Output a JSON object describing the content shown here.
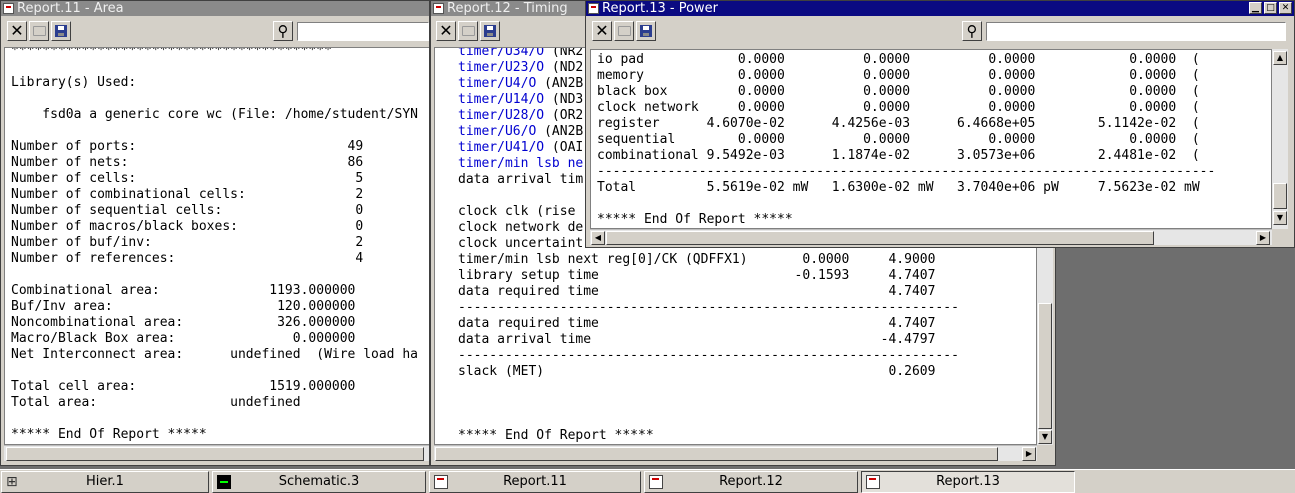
{
  "windows": {
    "area": {
      "title": "Report.11 - Area",
      "lines": [
        "*****************************************",
        "",
        "Library(s) Used:",
        "",
        "    fsd0a a generic core wc (File: /home/student/SYN",
        "",
        "Number of ports:                           49",
        "Number of nets:                            86",
        "Number of cells:                            5",
        "Number of combinational cells:              2",
        "Number of sequential cells:                 0",
        "Number of macros/black boxes:               0",
        "Number of buf/inv:                          2",
        "Number of references:                       4",
        "",
        "Combinational area:              1193.000000",
        "Buf/Inv area:                     120.000000",
        "Noncombinational area:            326.000000",
        "Macro/Black Box area:               0.000000",
        "Net Interconnect area:      undefined  (Wire load ha",
        "",
        "Total cell area:                 1519.000000",
        "Total area:                 undefined",
        "",
        "***** End Of Report *****"
      ]
    },
    "timing": {
      "title": "Report.12 - Timing",
      "links": [
        {
          "link": "timer/U34/O",
          "rest": " (NR2"
        },
        {
          "link": "timer/U23/O",
          "rest": " (ND2"
        },
        {
          "link": "timer/U4/O",
          "rest": " (AN2B"
        },
        {
          "link": "timer/U14/O",
          "rest": " (ND3"
        },
        {
          "link": "timer/U28/O",
          "rest": " (OR2"
        },
        {
          "link": "timer/U6/O",
          "rest": " (AN2B"
        },
        {
          "link": "timer/U41/O",
          "rest": " (OAI"
        },
        {
          "link": "timer/min lsb ne",
          "rest": ""
        }
      ],
      "lines_top": [
        "data arrival tim",
        "",
        "clock clk (rise",
        "clock network de",
        "clock uncertaint"
      ],
      "lines_bottom": [
        "timer/min lsb next reg[0]/CK (QDFFX1)       0.0000     4.9000",
        "library setup time                         -0.1593     4.7407",
        "data required time                                     4.7407",
        "----------------------------------------------------------------",
        "data required time                                     4.7407",
        "data arrival time                                     -4.4797",
        "----------------------------------------------------------------",
        "slack (MET)                                            0.2609",
        "",
        "",
        "",
        "***** End Of Report *****"
      ]
    },
    "power": {
      "title": "Report.13 - Power",
      "lines": [
        "io pad            0.0000          0.0000          0.0000            0.0000  (",
        "memory            0.0000          0.0000          0.0000            0.0000  (",
        "black box         0.0000          0.0000          0.0000            0.0000  (",
        "clock network     0.0000          0.0000          0.0000            0.0000  (",
        "register      4.6070e-02      4.4256e-03      6.4668e+05        5.1142e-02  (",
        "sequential        0.0000          0.0000          0.0000            0.0000  (",
        "combinational 9.5492e-03      1.1874e-02      3.0573e+06        2.4481e-02  (",
        "-------------------------------------------------------------------------------",
        "Total         5.5619e-02 mW   1.6300e-02 mW   3.7040e+06 pW     7.5623e-02 mW",
        "",
        "***** End Of Report *****"
      ]
    }
  },
  "toolbar": {
    "close_glyph": "✕",
    "find_glyph": "⚲"
  },
  "taskbar": {
    "items": [
      {
        "label": "Hier.1",
        "icon": "hierarchy-icon"
      },
      {
        "label": "Schematic.3",
        "icon": "schematic-icon"
      },
      {
        "label": "Report.11",
        "icon": "report-icon"
      },
      {
        "label": "Report.12",
        "icon": "report-icon"
      },
      {
        "label": "Report.13",
        "icon": "report-icon"
      }
    ]
  },
  "colors": {
    "title_active": "#0a0a82",
    "title_inactive": "#8a8a8a",
    "link_blue": "#0000d0"
  }
}
